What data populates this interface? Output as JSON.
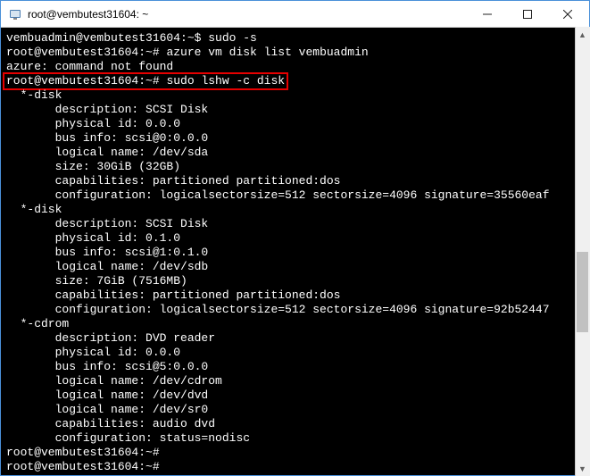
{
  "window": {
    "title": "root@vembutest31604: ~"
  },
  "terminal": {
    "line1_prompt": "vembuadmin@vembutest31604:~$",
    "line1_cmd": " sudo -s",
    "line2_prompt": "root@vembutest31604:~#",
    "line2_cmd": " azure vm disk list vembuadmin",
    "line3": "azure: command not found",
    "line4_prompt": "root@vembutest31604:~#",
    "line4_cmd": " sudo lshw -c disk",
    "disk1": {
      "header": "  *-disk",
      "description": "       description: SCSI Disk",
      "physical_id": "       physical id: 0.0.0",
      "bus_info": "       bus info: scsi@0:0.0.0",
      "logical_name": "       logical name: /dev/sda",
      "size": "       size: 30GiB (32GB)",
      "capabilities": "       capabilities: partitioned partitioned:dos",
      "configuration": "       configuration: logicalsectorsize=512 sectorsize=4096 signature=35560eaf"
    },
    "disk2": {
      "header": "  *-disk",
      "description": "       description: SCSI Disk",
      "physical_id": "       physical id: 0.1.0",
      "bus_info": "       bus info: scsi@1:0.1.0",
      "logical_name": "       logical name: /dev/sdb",
      "size": "       size: 7GiB (7516MB)",
      "capabilities": "       capabilities: partitioned partitioned:dos",
      "configuration": "       configuration: logicalsectorsize=512 sectorsize=4096 signature=92b52447"
    },
    "cdrom": {
      "header": "  *-cdrom",
      "description": "       description: DVD reader",
      "physical_id": "       physical id: 0.0.0",
      "bus_info": "       bus info: scsi@5:0.0.0",
      "logical_name1": "       logical name: /dev/cdrom",
      "logical_name2": "       logical name: /dev/dvd",
      "logical_name3": "       logical name: /dev/sr0",
      "capabilities": "       capabilities: audio dvd",
      "configuration": "       configuration: status=nodisc"
    },
    "end_prompt1": "root@vembutest31604:~#",
    "end_prompt2": "root@vembutest31604:~#"
  }
}
